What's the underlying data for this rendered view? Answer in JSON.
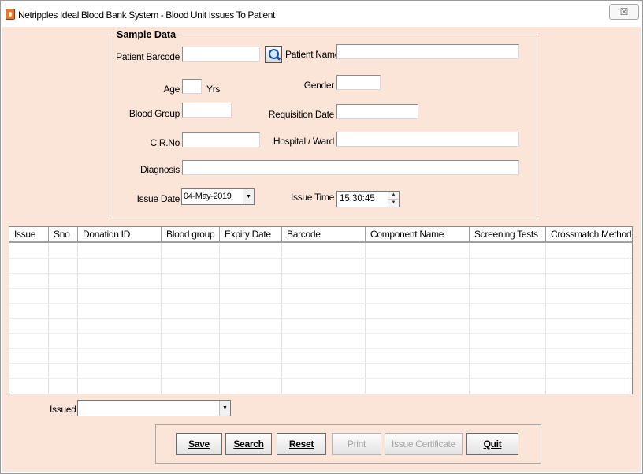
{
  "window": {
    "title": "Netripples Ideal Blood Bank System - Blood Unit Issues To Patient",
    "close_glyph": "☒"
  },
  "sample_data": {
    "title": "Sample Data",
    "patient_barcode_label": "Patient Barcode",
    "patient_barcode_value": "",
    "patient_name_label": "Patient Name",
    "patient_name_value": "",
    "age_label": "Age",
    "age_value": "",
    "age_unit": "Yrs",
    "gender_label": "Gender",
    "gender_value": "",
    "blood_group_label": "Blood Group",
    "blood_group_value": "",
    "requisition_date_label": "Requisition Date",
    "requisition_date_value": "",
    "crno_label": "C.R.No",
    "crno_value": "",
    "hospital_ward_label": "Hospital / Ward",
    "hospital_ward_value": "",
    "diagnosis_label": "Diagnosis",
    "diagnosis_value": "",
    "issue_date_label": "Issue Date",
    "issue_date_value": "04-May-2019",
    "issue_time_label": "Issue Time",
    "issue_time_value": "15:30:45"
  },
  "grid": {
    "columns": [
      "Issue",
      "Sno",
      "Donation ID",
      "Blood group",
      "Expiry Date",
      "Barcode",
      "Component Name",
      "Screening Tests",
      "Crossmatch Method"
    ],
    "rows": []
  },
  "issued": {
    "label": "Issued",
    "value": ""
  },
  "buttons": {
    "save": "Save",
    "search": "Search",
    "reset": "Reset",
    "print": "Print",
    "issue_certificate": "Issue Certificate",
    "quit": "Quit"
  },
  "icons": {
    "app": "blood-bank-app-icon",
    "search": "magnifier-icon",
    "dropdown": "chevron-down-icon",
    "spin_up": "spin-up-icon",
    "spin_down": "spin-down-icon"
  }
}
